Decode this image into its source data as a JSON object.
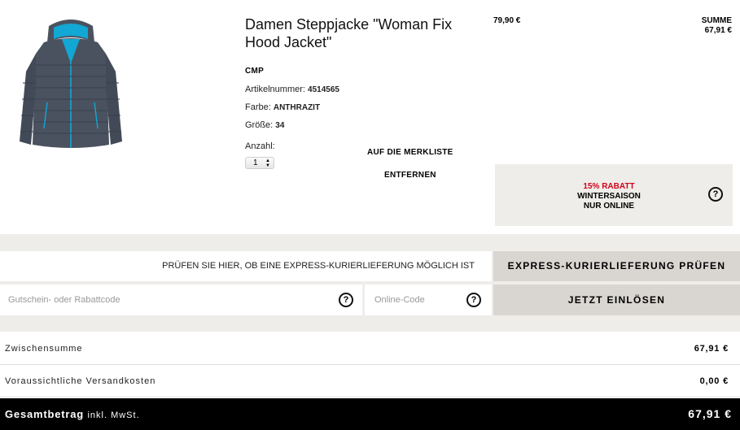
{
  "product": {
    "title": "Damen Steppjacke \"Woman Fix Hood Jacket\"",
    "brand": "CMP",
    "article_label": "Artikelnummer:",
    "article_number": "4514565",
    "color_label": "Farbe:",
    "color_value": "ANTHRAZIT",
    "size_label": "Größe:",
    "size_value": "34",
    "quantity_label": "Anzahl:",
    "quantity_value": "1",
    "wishlist_label": "AUF DIE MERKLISTE",
    "remove_label": "ENTFERNEN",
    "unit_price": "79,90 €",
    "sum_label": "SUMME",
    "sum_value": "67,91 €",
    "image_colors": {
      "jacket": "#4a5260",
      "lining": "#12a7d4"
    }
  },
  "promo": {
    "discount": "15% RABATT",
    "line2": "WINTERSAISON",
    "line3": "NUR ONLINE",
    "accent": "#d0021b"
  },
  "express": {
    "prompt": "PRÜFEN SIE HIER, OB EINE EXPRESS-KURIERLIEFERUNG MÖGLICH IST",
    "button": "EXPRESS-KURIERLIEFERUNG PRÜFEN"
  },
  "coupon": {
    "placeholder": "Gutschein- oder Rabattcode",
    "online_placeholder": "Online-Code",
    "button": "JETZT EINLÖSEN"
  },
  "totals": {
    "subtotal_label": "Zwischensumme",
    "subtotal_value": "67,91 €",
    "shipping_label": "Voraussichtliche Versandkosten",
    "shipping_value": "0,00 €",
    "grand_label": "Gesamtbetrag",
    "grand_sub": "inkl. MwSt.",
    "grand_value": "67,91 €"
  }
}
